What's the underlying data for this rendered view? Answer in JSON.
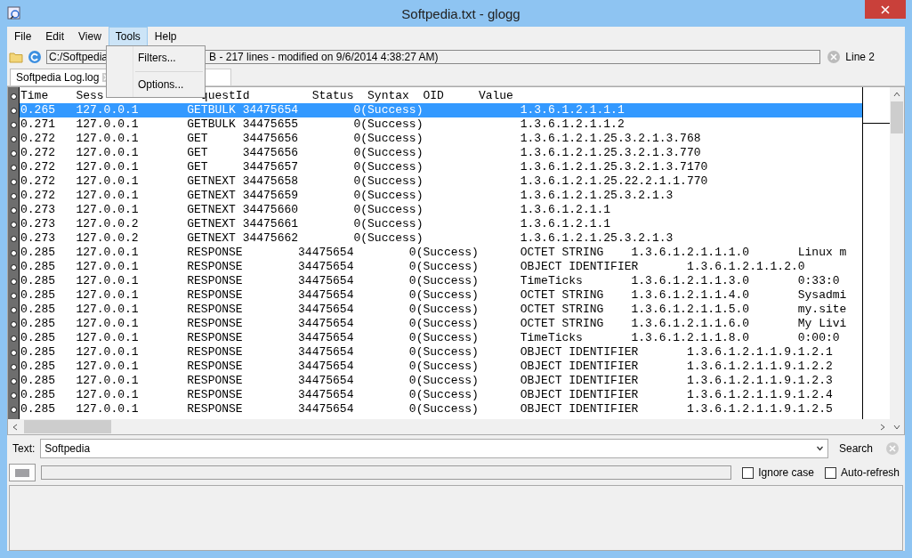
{
  "window": {
    "title": "Softpedia.txt - glogg"
  },
  "menu": [
    {
      "label": "File",
      "selected": false
    },
    {
      "label": "Edit",
      "selected": false
    },
    {
      "label": "View",
      "selected": false
    },
    {
      "label": "Tools",
      "selected": true
    },
    {
      "label": "Help",
      "selected": false
    }
  ],
  "dropdown": [
    {
      "label": "Filters..."
    },
    {
      "label": "Options..."
    }
  ],
  "toolbar": {
    "path_start": "C:/Softpedia",
    "path_end": "B - 217 lines - modified on 9/6/2014 4:38:27 AM)",
    "line": "Line 2"
  },
  "tabs": [
    {
      "label": "Softpedia Log.log",
      "selected": true
    }
  ],
  "log": {
    "header_start": "Time    Sess",
    "header_end": "questId         Status  Syntax  OID     Value",
    "lines": [
      {
        "text": "0.265   127.0.0.1       GETBULK 34475654        0(Success)              1.3.6.1.2.1.1.1",
        "selected": true
      },
      {
        "text": "0.271   127.0.0.1       GETBULK 34475655        0(Success)              1.3.6.1.2.1.1.2",
        "selected": false
      },
      {
        "text": "0.272   127.0.0.1       GET     34475656        0(Success)              1.3.6.1.2.1.25.3.2.1.3.768",
        "selected": false
      },
      {
        "text": "0.272   127.0.0.1       GET     34475656        0(Success)              1.3.6.1.2.1.25.3.2.1.3.770",
        "selected": false
      },
      {
        "text": "0.272   127.0.0.1       GET     34475657        0(Success)              1.3.6.1.2.1.25.3.2.1.3.7170",
        "selected": false
      },
      {
        "text": "0.272   127.0.0.1       GETNEXT 34475658        0(Success)              1.3.6.1.2.1.25.22.2.1.1.770",
        "selected": false
      },
      {
        "text": "0.272   127.0.0.1       GETNEXT 34475659        0(Success)              1.3.6.1.2.1.25.3.2.1.3",
        "selected": false
      },
      {
        "text": "0.273   127.0.0.1       GETNEXT 34475660        0(Success)              1.3.6.1.2.1.1",
        "selected": false
      },
      {
        "text": "0.273   127.0.0.2       GETNEXT 34475661        0(Success)              1.3.6.1.2.1.1",
        "selected": false
      },
      {
        "text": "0.273   127.0.0.2       GETNEXT 34475662        0(Success)              1.3.6.1.2.1.25.3.2.1.3",
        "selected": false
      },
      {
        "text": "0.285   127.0.0.1       RESPONSE        34475654        0(Success)      OCTET STRING    1.3.6.1.2.1.1.1.0       Linux m",
        "selected": false
      },
      {
        "text": "0.285   127.0.0.1       RESPONSE        34475654        0(Success)      OBJECT IDENTIFIER       1.3.6.1.2.1.1.2.0",
        "selected": false
      },
      {
        "text": "0.285   127.0.0.1       RESPONSE        34475654        0(Success)      TimeTicks       1.3.6.1.2.1.1.3.0       0:33:0",
        "selected": false
      },
      {
        "text": "0.285   127.0.0.1       RESPONSE        34475654        0(Success)      OCTET STRING    1.3.6.1.2.1.1.4.0       Sysadmi",
        "selected": false
      },
      {
        "text": "0.285   127.0.0.1       RESPONSE        34475654        0(Success)      OCTET STRING    1.3.6.1.2.1.1.5.0       my.site",
        "selected": false
      },
      {
        "text": "0.285   127.0.0.1       RESPONSE        34475654        0(Success)      OCTET STRING    1.3.6.1.2.1.1.6.0       My Livi",
        "selected": false
      },
      {
        "text": "0.285   127.0.0.1       RESPONSE        34475654        0(Success)      TimeTicks       1.3.6.1.2.1.1.8.0       0:00:0",
        "selected": false
      },
      {
        "text": "0.285   127.0.0.1       RESPONSE        34475654        0(Success)      OBJECT IDENTIFIER       1.3.6.1.2.1.1.9.1.2.1",
        "selected": false
      },
      {
        "text": "0.285   127.0.0.1       RESPONSE        34475654        0(Success)      OBJECT IDENTIFIER       1.3.6.1.2.1.1.9.1.2.2",
        "selected": false
      },
      {
        "text": "0.285   127.0.0.1       RESPONSE        34475654        0(Success)      OBJECT IDENTIFIER       1.3.6.1.2.1.1.9.1.2.3",
        "selected": false
      },
      {
        "text": "0.285   127.0.0.1       RESPONSE        34475654        0(Success)      OBJECT IDENTIFIER       1.3.6.1.2.1.1.9.1.2.4",
        "selected": false
      },
      {
        "text": "0.285   127.0.0.1       RESPONSE        34475654        0(Success)      OBJECT IDENTIFIER       1.3.6.1.2.1.1.9.1.2.5",
        "selected": false
      }
    ]
  },
  "search": {
    "label": "Text:",
    "value": "Softpedia",
    "button": "Search"
  },
  "progress": {
    "level": 0
  },
  "options": [
    {
      "label": "Ignore case",
      "checked": false
    },
    {
      "label": "Auto-refresh",
      "checked": false
    }
  ]
}
